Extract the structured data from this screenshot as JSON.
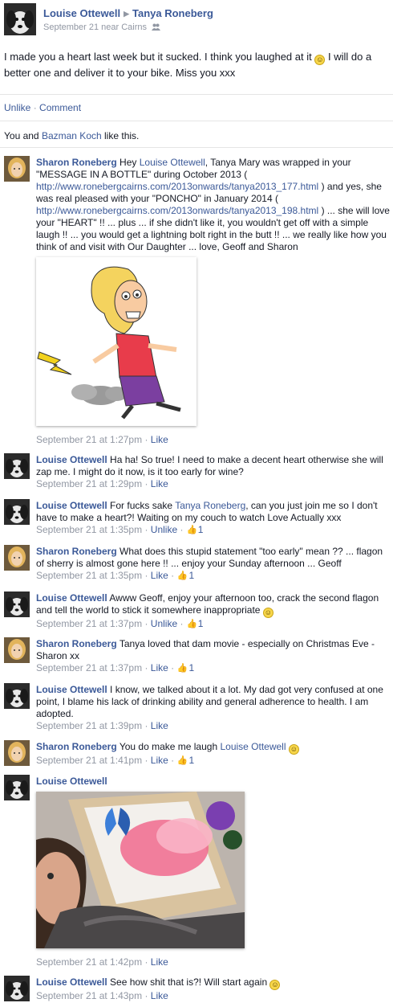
{
  "post": {
    "author": "Louise Ottewell",
    "target": "Tanya Roneberg",
    "meta": "September 21 near Cairns",
    "text": "I made you a heart last week but it sucked. I think you laughed at it",
    "text_tail": "I will do a better one and deliver it to your bike. Miss you xxx",
    "unlike": "Unlike",
    "comment": "Comment",
    "likes_prefix": "You and",
    "likes_person": "Bazman Koch",
    "likes_suffix": "like this."
  },
  "comments": [
    {
      "author": "Sharon Roneberg",
      "p1": "Hey",
      "mention": "Louise Ottewell",
      "p2": ", Tanya Mary was wrapped in your \"MESSAGE IN A BOTTLE\" during October 2013 (",
      "link1": "http://www.ronebergcairns.com/2013onwards/tanya2013_177.html",
      "p3": ") and yes, she was real pleased with your \"PONCHO\" in January 2014 (",
      "link2": "http://www.ronebergcairns.com/2013onwards/tanya2013_198.html",
      "p4": ") ... she will love your \"HEART\" !! ... plus ... if she didn't like it, you wouldn't get off with a simple laugh !! ... you would get a lightning bolt right in the butt !! ... we really like how you think of and visit with Our Daughter ... love, Geoff and Sharon",
      "time": "September 21 at 1:27pm",
      "like": "Like"
    },
    {
      "author": "Louise Ottewell",
      "text": "Ha ha! So true! I need to make a decent heart otherwise she will zap me. I might do it now, is it too early for wine?",
      "time": "September 21 at 1:29pm",
      "like": "Like"
    },
    {
      "author": "Louise Ottewell",
      "p1": "For fucks sake",
      "mention": "Tanya Roneberg",
      "p2": ", can you just join me so I don't have to make a heart?! Waiting on my couch to watch Love Actually xxx",
      "time": "September 21 at 1:35pm",
      "like": "Unlike",
      "count": "1"
    },
    {
      "author": "Sharon Roneberg",
      "text": "What does this stupid statement \"too early\" mean ?? ... flagon of sherry is almost gone here !! ... enjoy your Sunday afternoon ... Geoff",
      "time": "September 21 at 1:35pm",
      "like": "Like",
      "count": "1"
    },
    {
      "author": "Louise Ottewell",
      "text": "Awww Geoff, enjoy your afternoon too, crack the second flagon and tell the world to stick it somewhere inappropriate",
      "time": "September 21 at 1:37pm",
      "like": "Unlike",
      "count": "1"
    },
    {
      "author": "Sharon Roneberg",
      "text": "Tanya loved that dam movie - especially on Christmas Eve - Sharon xx",
      "time": "September 21 at 1:37pm",
      "like": "Like",
      "count": "1"
    },
    {
      "author": "Louise Ottewell",
      "text": "I know, we talked about it a lot. My dad got very confused at one point, I blame his lack of drinking ability and general adherence to health. I am adopted.",
      "time": "September 21 at 1:39pm",
      "like": "Like"
    },
    {
      "author": "Sharon Roneberg",
      "p1": "You do make me laugh",
      "mention": "Louise Ottewell",
      "time": "September 21 at 1:41pm",
      "like": "Like",
      "count": "1"
    },
    {
      "author": "Louise Ottewell",
      "time": "September 21 at 1:42pm",
      "like": "Like"
    },
    {
      "author": "Louise Ottewell",
      "text": "See how shit that is?! Will start again",
      "time": "September 21 at 1:43pm",
      "like": "Like"
    }
  ],
  "sep": "·",
  "smiley_glyph": "☺",
  "thumb_glyph": "👍",
  "colors": {
    "link": "#3b5998",
    "meta": "#9197a3",
    "text": "#141823"
  }
}
